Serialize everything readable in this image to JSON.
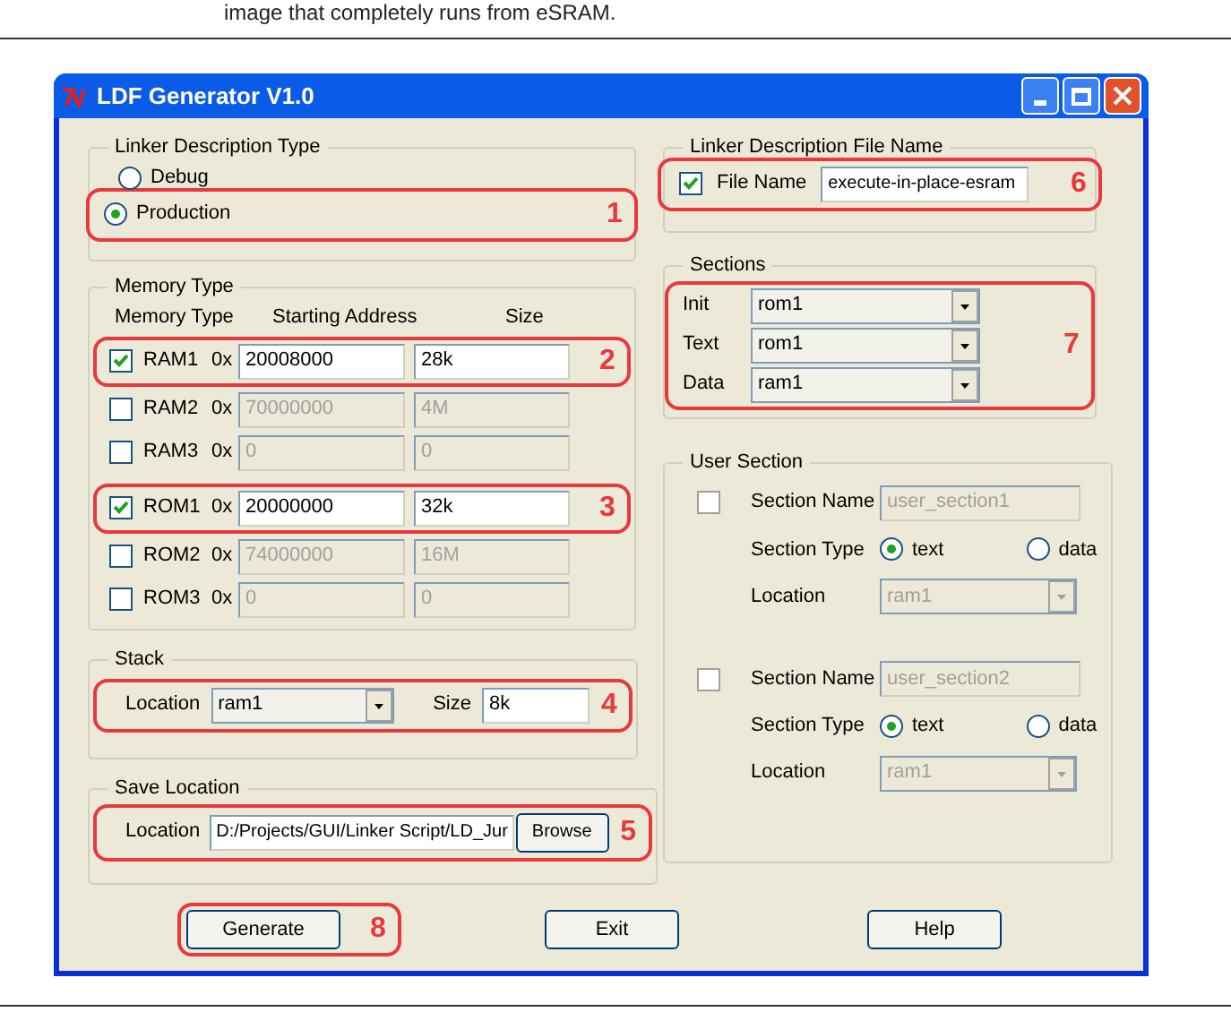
{
  "doc_text": "image that completely runs from eSRAM.",
  "window": {
    "title": "LDF Generator V1.0"
  },
  "linker_type": {
    "title": "Linker Description Type",
    "callout": "1",
    "options": [
      {
        "label": "Debug",
        "selected": false
      },
      {
        "label": "Production",
        "selected": true
      }
    ]
  },
  "memory": {
    "title": "Memory Type",
    "columns": [
      "Memory Type",
      "Starting Address",
      "Size"
    ],
    "groups": [
      {
        "rows": [
          {
            "name": "RAM1",
            "checked": true,
            "prefix": "0x",
            "address": "20008000",
            "size": "28k",
            "callout": "2"
          },
          {
            "name": "RAM2",
            "checked": false,
            "prefix": "0x",
            "address": "70000000",
            "size": "4M"
          },
          {
            "name": "RAM3",
            "checked": false,
            "prefix": "0x",
            "address": "0",
            "size": "0"
          }
        ]
      },
      {
        "rows": [
          {
            "name": "ROM1",
            "checked": true,
            "prefix": "0x",
            "address": "20000000",
            "size": "32k",
            "callout": "3"
          },
          {
            "name": "ROM2",
            "checked": false,
            "prefix": "0x",
            "address": "74000000",
            "size": "16M"
          },
          {
            "name": "ROM3",
            "checked": false,
            "prefix": "0x",
            "address": "0",
            "size": "0"
          }
        ]
      }
    ]
  },
  "stack": {
    "title": "Stack",
    "location_label": "Location",
    "location": "ram1",
    "size_label": "Size",
    "size": "8k",
    "callout": "4"
  },
  "save": {
    "title": "Save Location",
    "label": "Location",
    "path": "D:/Projects/GUI/Linker Script/LD_Jur",
    "browse": "Browse",
    "callout": "5"
  },
  "file_name": {
    "title": "Linker Description File Name",
    "checked": true,
    "label": "File Name",
    "value": "execute-in-place-esram",
    "callout": "6"
  },
  "sections": {
    "title": "Sections",
    "callout": "7",
    "rows": [
      {
        "label": "Init",
        "value": "rom1"
      },
      {
        "label": "Text",
        "value": "rom1"
      },
      {
        "label": "Data",
        "value": "ram1"
      }
    ]
  },
  "user_section": {
    "title": "User Section",
    "items": [
      {
        "checked": false,
        "name_label": "Section Name",
        "name": "user_section1",
        "type_label": "Section Type",
        "types": [
          {
            "label": "text",
            "selected": true
          },
          {
            "label": "data",
            "selected": false
          }
        ],
        "location_label": "Location",
        "location": "ram1"
      },
      {
        "checked": false,
        "name_label": "Section Name",
        "name": "user_section2",
        "type_label": "Section Type",
        "types": [
          {
            "label": "text",
            "selected": true
          },
          {
            "label": "data",
            "selected": false
          }
        ],
        "location_label": "Location",
        "location": "ram1"
      }
    ]
  },
  "buttons": [
    {
      "label": "Generate",
      "callout": "8"
    },
    {
      "label": "Exit"
    },
    {
      "label": "Help"
    }
  ]
}
